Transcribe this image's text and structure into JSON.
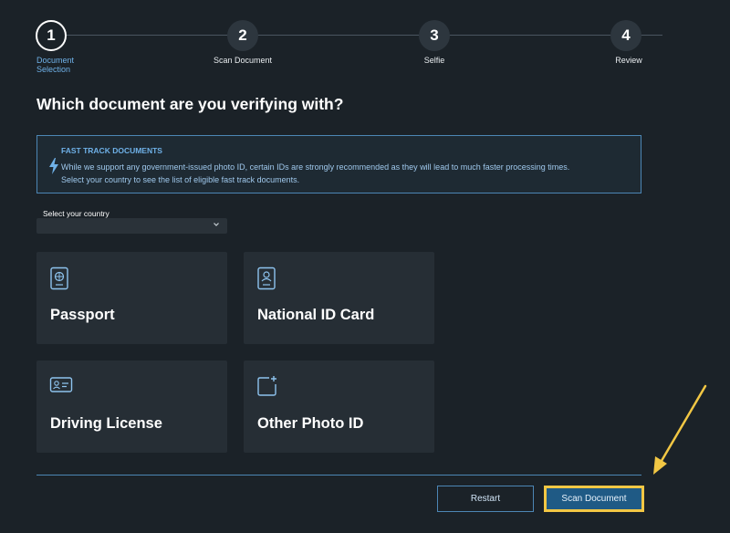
{
  "stepper": {
    "steps": [
      {
        "number": "1",
        "label": "Document Selection",
        "active": true
      },
      {
        "number": "2",
        "label": "Scan Document",
        "active": false
      },
      {
        "number": "3",
        "label": "Selfie",
        "active": false
      },
      {
        "number": "4",
        "label": "Review",
        "active": false
      }
    ]
  },
  "page_title": "Which document are you verifying with?",
  "info_box": {
    "title": "FAST TRACK DOCUMENTS",
    "line1": "While we support any government-issued photo ID, certain IDs are strongly recommended as they will lead to much faster processing times.",
    "line2": "Select your country to see the list of eligible fast track documents.",
    "icon": "lightning-icon"
  },
  "country": {
    "label": "Select your country",
    "value": ""
  },
  "documents": [
    {
      "label": "Passport",
      "icon": "passport-icon"
    },
    {
      "label": "National ID Card",
      "icon": "national-id-icon"
    },
    {
      "label": "Driving License",
      "icon": "driving-license-icon"
    },
    {
      "label": "Other Photo ID",
      "icon": "add-photo-id-icon"
    }
  ],
  "actions": {
    "restart_label": "Restart",
    "scan_label": "Scan Document"
  },
  "colors": {
    "background": "#1b2228",
    "accent": "#4c86b5",
    "highlight": "#f2c744"
  }
}
